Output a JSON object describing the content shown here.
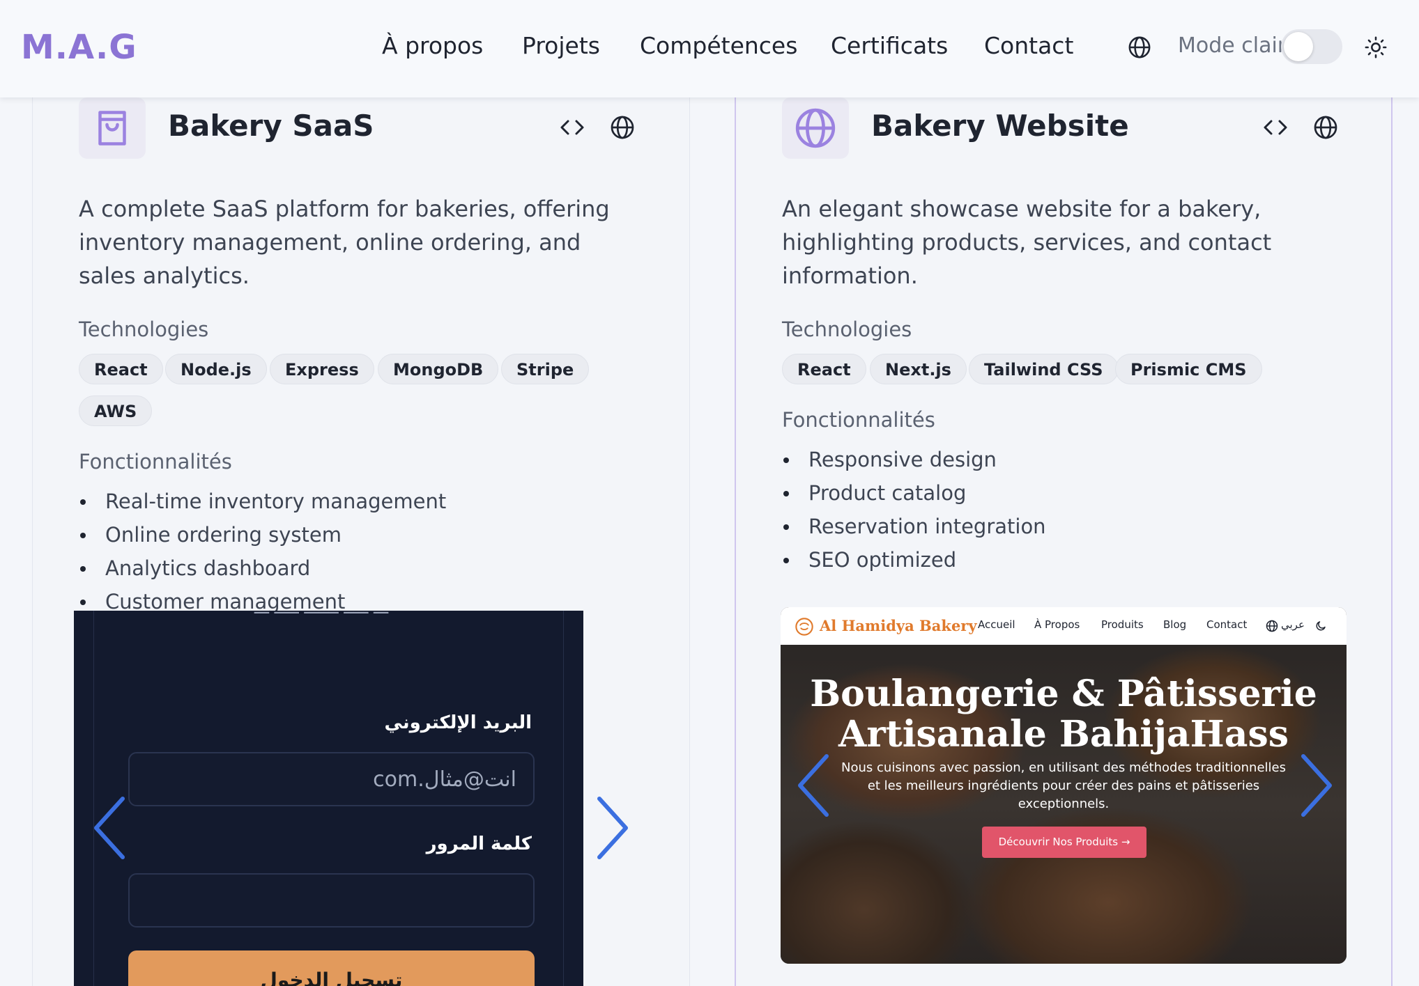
{
  "header": {
    "logo": "M.A.G",
    "nav": [
      "À propos",
      "Projets",
      "Compétences",
      "Certificats",
      "Contact"
    ],
    "mode_label": "Mode clair",
    "icons": [
      "globe-icon",
      "sun-icon"
    ]
  },
  "projects": [
    {
      "title": "Bakery SaaS",
      "icon": "shopping-bag-icon",
      "description": "A complete SaaS platform for bakeries, offering inventory management, online ordering, and sales analytics.",
      "tech_label": "Technologies",
      "technologies": [
        "React",
        "Node.js",
        "Express",
        "MongoDB",
        "Stripe",
        "AWS"
      ],
      "features_label": "Fonctionnalités",
      "features": [
        "Real-time inventory management",
        "Online ordering system",
        "Analytics dashboard",
        "Customer management"
      ],
      "screenshot": {
        "email_label": "البريد الإلكتروني",
        "email_placeholder": "انت@مثال.com",
        "password_label": "كلمة المرور",
        "submit_label": "تسجيل الدخول"
      }
    },
    {
      "title": "Bakery Website",
      "icon": "globe-icon",
      "description": "An elegant showcase website for a bakery, highlighting products, services, and contact information.",
      "tech_label": "Technologies",
      "technologies": [
        "React",
        "Next.js",
        "Tailwind CSS",
        "Prismic CMS"
      ],
      "features_label": "Fonctionnalités",
      "features": [
        "Responsive design",
        "Product catalog",
        "Reservation integration",
        "SEO optimized"
      ],
      "screenshot": {
        "brand": "Al Hamidya Bakery",
        "nav": [
          "Accueil",
          "À Propos",
          "Produits",
          "Blog",
          "Contact"
        ],
        "lang": "عربي",
        "hero_title_1": "Boulangerie & Pâtisserie",
        "hero_title_2": "Artisanale BahijaHass",
        "hero_sub": "Nous cuisinons avec passion, en utilisant des méthodes traditionnelles et les meilleurs ingrédients pour créer des pains et pâtisseries exceptionnels.",
        "cta": "Découvrir Nos Produits →"
      }
    }
  ],
  "colors": {
    "accent": "#8b74d4",
    "carousel_arrow": "#3b6fe0",
    "cta": "#e1556a",
    "login_button": "#e29a5c"
  }
}
